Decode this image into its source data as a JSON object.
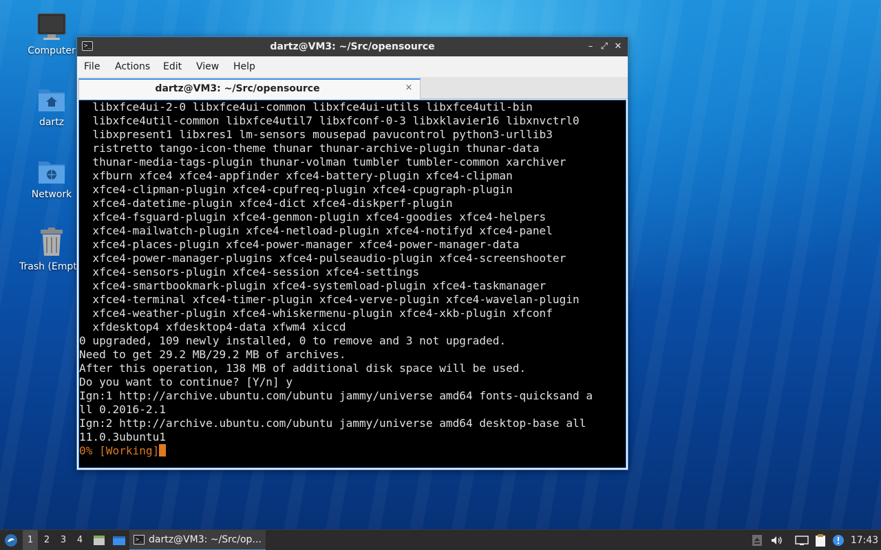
{
  "desktop": {
    "icons": [
      {
        "label": "Computer"
      },
      {
        "label": "dartz"
      },
      {
        "label": "Network"
      },
      {
        "label": "Trash (Empty)"
      }
    ]
  },
  "window": {
    "title": "dartz@VM3: ~/Src/opensource",
    "menu": [
      "File",
      "Actions",
      "Edit",
      "View",
      "Help"
    ],
    "tab_label": "dartz@VM3: ~/Src/opensource",
    "tab_close": "×",
    "controls": {
      "minimize": "–",
      "maximize": "⤢",
      "close": "✕"
    }
  },
  "terminal": {
    "lines": [
      "  libxfce4ui-2-0 libxfce4ui-common libxfce4ui-utils libxfce4util-bin",
      "  libxfce4util-common libxfce4util7 libxfconf-0-3 libxklavier16 libxnvctrl0",
      "  libxpresent1 libxres1 lm-sensors mousepad pavucontrol python3-urllib3",
      "  ristretto tango-icon-theme thunar thunar-archive-plugin thunar-data",
      "  thunar-media-tags-plugin thunar-volman tumbler tumbler-common xarchiver",
      "  xfburn xfce4 xfce4-appfinder xfce4-battery-plugin xfce4-clipman",
      "  xfce4-clipman-plugin xfce4-cpufreq-plugin xfce4-cpugraph-plugin",
      "  xfce4-datetime-plugin xfce4-dict xfce4-diskperf-plugin",
      "  xfce4-fsguard-plugin xfce4-genmon-plugin xfce4-goodies xfce4-helpers",
      "  xfce4-mailwatch-plugin xfce4-netload-plugin xfce4-notifyd xfce4-panel",
      "  xfce4-places-plugin xfce4-power-manager xfce4-power-manager-data",
      "  xfce4-power-manager-plugins xfce4-pulseaudio-plugin xfce4-screenshooter",
      "  xfce4-sensors-plugin xfce4-session xfce4-settings",
      "  xfce4-smartbookmark-plugin xfce4-systemload-plugin xfce4-taskmanager",
      "  xfce4-terminal xfce4-timer-plugin xfce4-verve-plugin xfce4-wavelan-plugin",
      "  xfce4-weather-plugin xfce4-whiskermenu-plugin xfce4-xkb-plugin xfconf",
      "  xfdesktop4 xfdesktop4-data xfwm4 xiccd",
      "0 upgraded, 109 newly installed, 0 to remove and 3 not upgraded.",
      "Need to get 29.2 MB/29.2 MB of archives.",
      "After this operation, 138 MB of additional disk space will be used.",
      "Do you want to continue? [Y/n] y",
      "Ign:1 http://archive.ubuntu.com/ubuntu jammy/universe amd64 fonts-quicksand a",
      "ll 0.2016-2.1",
      "Ign:2 http://archive.ubuntu.com/ubuntu jammy/universe amd64 desktop-base all",
      "11.0.3ubuntu1"
    ],
    "status_line": "0% [Working]",
    "status_color": "#d97a24"
  },
  "taskbar": {
    "workspaces": [
      "1",
      "2",
      "3",
      "4"
    ],
    "active_workspace": "1",
    "task_label": "dartz@VM3: ~/Src/op...",
    "clock": "17:43",
    "accent": "#3d8ee8"
  }
}
